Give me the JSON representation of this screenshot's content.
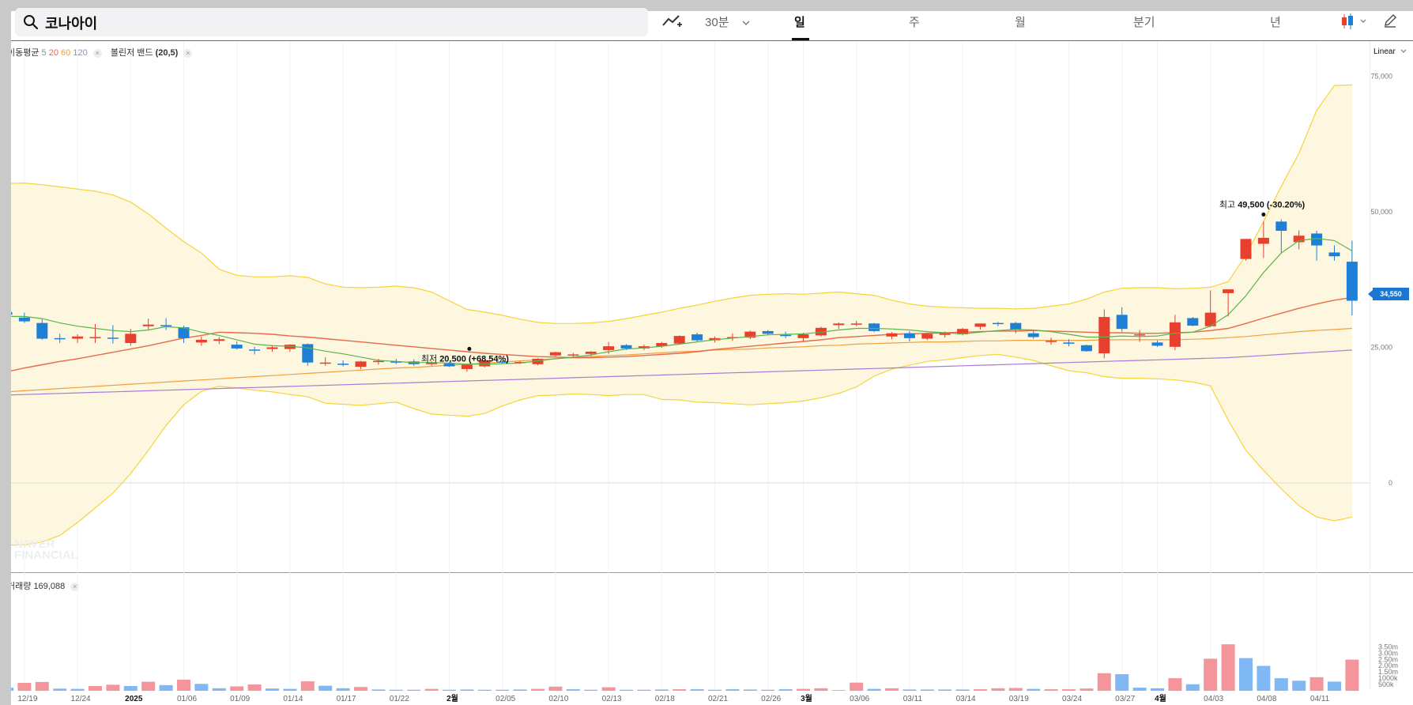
{
  "search": {
    "value": "코나아이",
    "icon": "search-icon"
  },
  "toolbar": {
    "interval": "30분",
    "periods": [
      {
        "label": "일",
        "active": true
      },
      {
        "label": "주",
        "active": false
      },
      {
        "label": "월",
        "active": false
      },
      {
        "label": "분기",
        "active": false
      },
      {
        "label": "년",
        "active": false
      }
    ],
    "icons": [
      "add-indicator-icon",
      "chevron-down-icon",
      "candle-chart-type-icon",
      "pencil-icon"
    ]
  },
  "legend": {
    "ma_label": "이동평균",
    "ma_periods": [
      {
        "label": "5",
        "color": "#59b44a"
      },
      {
        "label": "20",
        "color": "#e8694a"
      },
      {
        "label": "60",
        "color": "#f0a040"
      },
      {
        "label": "120",
        "color": "#a77bd6"
      }
    ],
    "bb_label": "볼린저 밴드",
    "bb_params": "(20,5)"
  },
  "scale": "Linear",
  "last_price": "34,550",
  "volume_label": "거래량",
  "volume_value": "169,088",
  "watermark": [
    "NAVER",
    "FINANCIAL"
  ],
  "colors": {
    "up": "#e8402d",
    "down": "#1e7fd6",
    "vol_up": "#f4959b",
    "vol_down": "#7fb8f4",
    "band": "#f5d33a",
    "band_fill": "#fdf7df"
  },
  "chart_data": {
    "type": "candlestick",
    "y_ticks": [
      "75,000",
      "50,000",
      "25,000",
      "0"
    ],
    "ylim": [
      0,
      75000
    ],
    "volume_ticks": [
      "3.50m",
      "3.00m",
      "2.50m",
      "2.00m",
      "1.50m",
      "1000k",
      "500k"
    ],
    "x_tick_labels": [
      {
        "label": "12/19",
        "i": 1
      },
      {
        "label": "12/24",
        "i": 4
      },
      {
        "label": "2025",
        "i": 7,
        "bold": true
      },
      {
        "label": "01/06",
        "i": 10
      },
      {
        "label": "01/09",
        "i": 13
      },
      {
        "label": "01/14",
        "i": 16
      },
      {
        "label": "01/17",
        "i": 19
      },
      {
        "label": "01/22",
        "i": 22
      },
      {
        "label": "2월",
        "i": 25,
        "bold": true
      },
      {
        "label": "02/05",
        "i": 28
      },
      {
        "label": "02/10",
        "i": 31
      },
      {
        "label": "02/13",
        "i": 34
      },
      {
        "label": "02/18",
        "i": 37
      },
      {
        "label": "02/21",
        "i": 40
      },
      {
        "label": "02/26",
        "i": 43
      },
      {
        "label": "3월",
        "i": 45,
        "bold": true
      },
      {
        "label": "03/06",
        "i": 48
      },
      {
        "label": "03/11",
        "i": 51
      },
      {
        "label": "03/14",
        "i": 54
      },
      {
        "label": "03/19",
        "i": 57
      },
      {
        "label": "03/24",
        "i": 60
      },
      {
        "label": "03/27",
        "i": 63
      },
      {
        "label": "4월",
        "i": 65,
        "bold": true
      },
      {
        "label": "04/03",
        "i": 68
      },
      {
        "label": "04/08",
        "i": 71
      },
      {
        "label": "04/11",
        "i": 74
      }
    ],
    "candles": [
      [
        31500,
        31900,
        30700,
        31000
      ],
      [
        30500,
        31400,
        29500,
        29800
      ],
      [
        29500,
        30200,
        26400,
        26600
      ],
      [
        26700,
        27500,
        25800,
        26500
      ],
      [
        26600,
        27400,
        25800,
        27000
      ],
      [
        26900,
        29300,
        25800,
        26900
      ],
      [
        26800,
        29100,
        25700,
        26700
      ],
      [
        25800,
        28400,
        25300,
        27500
      ],
      [
        28900,
        30300,
        28300,
        29200
      ],
      [
        29100,
        30400,
        28200,
        29000
      ],
      [
        28700,
        29000,
        25800,
        26700
      ],
      [
        25900,
        27000,
        25300,
        26400
      ],
      [
        26200,
        26900,
        25600,
        26500
      ],
      [
        25500,
        26100,
        24600,
        24800
      ],
      [
        24600,
        25100,
        23700,
        24500
      ],
      [
        24700,
        25400,
        24200,
        25000
      ],
      [
        24700,
        25600,
        24200,
        25500
      ],
      [
        25600,
        25700,
        21600,
        22200
      ],
      [
        22000,
        23200,
        21600,
        22200
      ],
      [
        22000,
        22600,
        21500,
        21800
      ],
      [
        21400,
        22500,
        21000,
        22400
      ],
      [
        22300,
        22900,
        21800,
        22500
      ],
      [
        22400,
        22900,
        21900,
        22300
      ],
      [
        22400,
        22800,
        21600,
        21900
      ],
      [
        21900,
        22500,
        21600,
        22200
      ],
      [
        22000,
        22300,
        21400,
        21500
      ],
      [
        21000,
        22000,
        20500,
        21800
      ],
      [
        21500,
        22600,
        21300,
        22600
      ],
      [
        22400,
        22600,
        22000,
        22200
      ],
      [
        22200,
        22500,
        21900,
        22300
      ],
      [
        21900,
        23000,
        21700,
        22900
      ],
      [
        23500,
        24200,
        23300,
        24100
      ],
      [
        23600,
        24000,
        23100,
        23700
      ],
      [
        23800,
        24300,
        23400,
        24200
      ],
      [
        24500,
        26000,
        23800,
        25200
      ],
      [
        25400,
        25600,
        24500,
        24800
      ],
      [
        24800,
        25500,
        24500,
        25200
      ],
      [
        25200,
        26000,
        24900,
        25800
      ],
      [
        25700,
        27200,
        25500,
        27100
      ],
      [
        27400,
        27700,
        26100,
        26300
      ],
      [
        26300,
        27000,
        25900,
        26700
      ],
      [
        26700,
        27600,
        26200,
        26900
      ],
      [
        26800,
        28100,
        26500,
        27900
      ],
      [
        28000,
        28200,
        27300,
        27500
      ],
      [
        27300,
        27900,
        26700,
        27200
      ],
      [
        26700,
        27700,
        26100,
        27400
      ],
      [
        27200,
        28800,
        27000,
        28600
      ],
      [
        29100,
        29600,
        28400,
        29400
      ],
      [
        29300,
        29900,
        28900,
        29400
      ],
      [
        29400,
        29500,
        27800,
        28000
      ],
      [
        27000,
        27800,
        26500,
        27600
      ],
      [
        27600,
        28000,
        26100,
        26700
      ],
      [
        26600,
        27700,
        26300,
        27500
      ],
      [
        27300,
        27900,
        26800,
        27600
      ],
      [
        27400,
        28600,
        27200,
        28400
      ],
      [
        28800,
        29300,
        28300,
        29400
      ],
      [
        29500,
        29700,
        28900,
        29400
      ],
      [
        29500,
        29700,
        27600,
        28200
      ],
      [
        27600,
        28000,
        26600,
        26900
      ],
      [
        26100,
        26800,
        25500,
        26200
      ],
      [
        25900,
        26500,
        25200,
        25700
      ],
      [
        25400,
        25500,
        24200,
        24300
      ],
      [
        23900,
        32000,
        23000,
        30600
      ],
      [
        31000,
        32400,
        27900,
        28400
      ],
      [
        27400,
        28200,
        26000,
        27400
      ],
      [
        25900,
        26300,
        25100,
        25300
      ],
      [
        25100,
        31000,
        24500,
        29600
      ],
      [
        30400,
        30600,
        28900,
        29000
      ],
      [
        28900,
        35500,
        28700,
        31400
      ],
      [
        35000,
        35700,
        30700,
        35700
      ],
      [
        41300,
        45000,
        41000,
        45000
      ],
      [
        44100,
        48200,
        41500,
        45200
      ],
      [
        48200,
        48600,
        42500,
        46500
      ],
      [
        44400,
        46600,
        43100,
        45600
      ],
      [
        46000,
        46500,
        41000,
        43800
      ],
      [
        42500,
        43800,
        41000,
        41800
      ],
      [
        40800,
        44700,
        30900,
        33600
      ]
    ],
    "ma5": [
      30700,
      30700,
      30300,
      29500,
      28900,
      28500,
      28100,
      27900,
      28200,
      28800,
      28600,
      27800,
      27200,
      26400,
      25600,
      25300,
      25200,
      24900,
      24300,
      23800,
      23200,
      22600,
      22400,
      22200,
      22200,
      22100,
      21900,
      21900,
      22000,
      22100,
      22500,
      22900,
      23200,
      23600,
      24200,
      24700,
      24900,
      25200,
      25600,
      26000,
      26400,
      26700,
      27000,
      27300,
      27400,
      27500,
      27800,
      28200,
      28500,
      28500,
      28400,
      28200,
      27900,
      27700,
      27500,
      27800,
      28100,
      28300,
      28200,
      27900,
      27400,
      26900,
      26900,
      27100,
      27000,
      27100,
      27600,
      27800,
      28900,
      31000,
      34500,
      38800,
      42400,
      44700,
      45100,
      44700,
      42800
    ],
    "ma20": [
      20500,
      21200,
      21800,
      22400,
      22900,
      23500,
      24100,
      24700,
      25300,
      26000,
      26700,
      27200,
      27800,
      27700,
      27600,
      27400,
      27100,
      26900,
      26600,
      26300,
      26000,
      25700,
      25400,
      25100,
      24800,
      24500,
      24200,
      23900,
      23700,
      23500,
      23300,
      23200,
      23100,
      23100,
      23200,
      23300,
      23500,
      23700,
      23900,
      24200,
      24600,
      24900,
      25200,
      25500,
      25800,
      26100,
      26400,
      26800,
      27000,
      27200,
      27400,
      27500,
      27600,
      27700,
      27800,
      27900,
      28000,
      28000,
      28100,
      28000,
      27900,
      27800,
      27700,
      27700,
      27600,
      27600,
      27700,
      27800,
      28100,
      28500,
      29400,
      30400,
      31300,
      32200,
      33000,
      33700,
      34200
    ],
    "ma60": [
      16800,
      17000,
      17200,
      17400,
      17600,
      17800,
      18000,
      18200,
      18400,
      18600,
      18800,
      19000,
      19200,
      19400,
      19600,
      19800,
      20000,
      20200,
      20400,
      20600,
      20800,
      21000,
      21200,
      21300,
      21500,
      21700,
      21900,
      22100,
      22300,
      22500,
      22700,
      22900,
      23100,
      23300,
      23500,
      23600,
      23800,
      24000,
      24200,
      24300,
      24500,
      24600,
      24700,
      24900,
      25000,
      25100,
      25300,
      25400,
      25600,
      25700,
      25800,
      25900,
      26000,
      26000,
      26100,
      26200,
      26200,
      26300,
      26300,
      26300,
      26300,
      26300,
      26400,
      26400,
      26400,
      26400,
      26400,
      26500,
      26600,
      26800,
      27000,
      27300,
      27600,
      27900,
      28100,
      28300,
      28500
    ],
    "ma120": [
      16200,
      16300,
      16400,
      16500,
      16600,
      16700,
      16800,
      16900,
      17000,
      17100,
      17200,
      17300,
      17400,
      17500,
      17600,
      17700,
      17800,
      17900,
      18000,
      18100,
      18200,
      18300,
      18400,
      18500,
      18600,
      18700,
      18800,
      18900,
      19000,
      19100,
      19200,
      19300,
      19400,
      19500,
      19600,
      19700,
      19800,
      19900,
      20000,
      20100,
      20200,
      20300,
      20400,
      20500,
      20600,
      20700,
      20800,
      20900,
      21000,
      21100,
      21200,
      21300,
      21400,
      21500,
      21600,
      21700,
      21800,
      21900,
      22000,
      22100,
      22200,
      22300,
      22400,
      22500,
      22600,
      22700,
      22800,
      22900,
      23000,
      23100,
      23300,
      23500,
      23700,
      23900,
      24100,
      24300,
      24500
    ],
    "bb_upper": [
      55200,
      55300,
      55000,
      54600,
      54200,
      53800,
      53100,
      51800,
      49600,
      47000,
      44500,
      42400,
      39400,
      38300,
      38000,
      38000,
      38200,
      37900,
      36700,
      36100,
      36000,
      36100,
      36300,
      36000,
      35200,
      33600,
      32000,
      31500,
      30900,
      30200,
      29600,
      29400,
      29400,
      29500,
      29800,
      30300,
      30900,
      31500,
      32200,
      32800,
      33500,
      34100,
      34600,
      34800,
      34900,
      34800,
      35000,
      35200,
      34900,
      34600,
      33700,
      33000,
      32600,
      32400,
      32300,
      32200,
      32200,
      32100,
      32200,
      32600,
      33000,
      33900,
      35200,
      35900,
      36000,
      36000,
      35800,
      35900,
      36100,
      37100,
      42000,
      48200,
      54700,
      60800,
      68700,
      73300,
      73400
    ],
    "bb_lower": [
      -11500,
      -11400,
      -10900,
      -9700,
      -7300,
      -4600,
      -1900,
      1700,
      6000,
      10600,
      14400,
      16900,
      17800,
      17500,
      17100,
      16800,
      16300,
      15900,
      14700,
      14500,
      14300,
      14600,
      14900,
      13700,
      12700,
      12500,
      12300,
      12800,
      14200,
      15300,
      16100,
      16200,
      16400,
      16300,
      16100,
      16300,
      16300,
      15400,
      15300,
      14900,
      14800,
      14600,
      14400,
      14600,
      14800,
      15100,
      15700,
      16500,
      17700,
      19700,
      21000,
      21700,
      22400,
      22700,
      23100,
      23500,
      23700,
      23200,
      22600,
      21600,
      20700,
      20300,
      19600,
      19300,
      19300,
      19200,
      19000,
      18600,
      17900,
      11600,
      6000,
      2300,
      -1100,
      -4200,
      -6300,
      -7000,
      -6300
    ],
    "volume": [
      [
        0.25,
        0
      ],
      [
        0.63,
        1
      ],
      [
        0.7,
        1
      ],
      [
        0.17,
        0
      ],
      [
        0.15,
        0
      ],
      [
        0.38,
        1
      ],
      [
        0.48,
        1
      ],
      [
        0.38,
        0
      ],
      [
        0.72,
        1
      ],
      [
        0.45,
        0
      ],
      [
        0.88,
        1
      ],
      [
        0.55,
        0
      ],
      [
        0.2,
        0
      ],
      [
        0.35,
        1
      ],
      [
        0.5,
        1
      ],
      [
        0.18,
        0
      ],
      [
        0.15,
        0
      ],
      [
        0.75,
        1
      ],
      [
        0.4,
        0
      ],
      [
        0.2,
        0
      ],
      [
        0.3,
        1
      ],
      [
        0.1,
        0
      ],
      [
        0.08,
        0
      ],
      [
        0.08,
        0
      ],
      [
        0.15,
        1
      ],
      [
        0.08,
        0
      ],
      [
        0.1,
        0
      ],
      [
        0.08,
        0
      ],
      [
        0.08,
        0
      ],
      [
        0.1,
        0
      ],
      [
        0.15,
        1
      ],
      [
        0.33,
        1
      ],
      [
        0.12,
        0
      ],
      [
        0.08,
        0
      ],
      [
        0.28,
        1
      ],
      [
        0.08,
        0
      ],
      [
        0.08,
        0
      ],
      [
        0.1,
        0
      ],
      [
        0.12,
        1
      ],
      [
        0.12,
        0
      ],
      [
        0.08,
        0
      ],
      [
        0.12,
        0
      ],
      [
        0.1,
        0
      ],
      [
        0.08,
        0
      ],
      [
        0.12,
        0
      ],
      [
        0.15,
        1
      ],
      [
        0.2,
        1
      ],
      [
        0.05,
        0
      ],
      [
        0.65,
        1
      ],
      [
        0.15,
        0
      ],
      [
        0.2,
        1
      ],
      [
        0.1,
        0
      ],
      [
        0.1,
        0
      ],
      [
        0.1,
        0
      ],
      [
        0.1,
        0
      ],
      [
        0.12,
        1
      ],
      [
        0.2,
        1
      ],
      [
        0.22,
        1
      ],
      [
        0.15,
        0
      ],
      [
        0.12,
        1
      ],
      [
        0.12,
        1
      ],
      [
        0.18,
        1
      ],
      [
        1.4,
        1
      ],
      [
        1.32,
        0
      ],
      [
        0.25,
        0
      ],
      [
        0.2,
        0
      ],
      [
        1.0,
        1
      ],
      [
        0.52,
        0
      ],
      [
        2.55,
        1
      ],
      [
        3.7,
        1
      ],
      [
        2.6,
        0
      ],
      [
        1.98,
        0
      ],
      [
        1.0,
        0
      ],
      [
        0.8,
        0
      ],
      [
        1.08,
        1
      ],
      [
        0.73,
        0
      ],
      [
        2.48,
        1
      ]
    ],
    "annotations": {
      "high": {
        "prefix": "최고",
        "text": "49,500 (-30.20%)",
        "value": 49500,
        "i": 71
      },
      "low": {
        "prefix": "최저",
        "text": "20,500 (+68.54%)",
        "value": 20500,
        "i": 26
      }
    }
  }
}
